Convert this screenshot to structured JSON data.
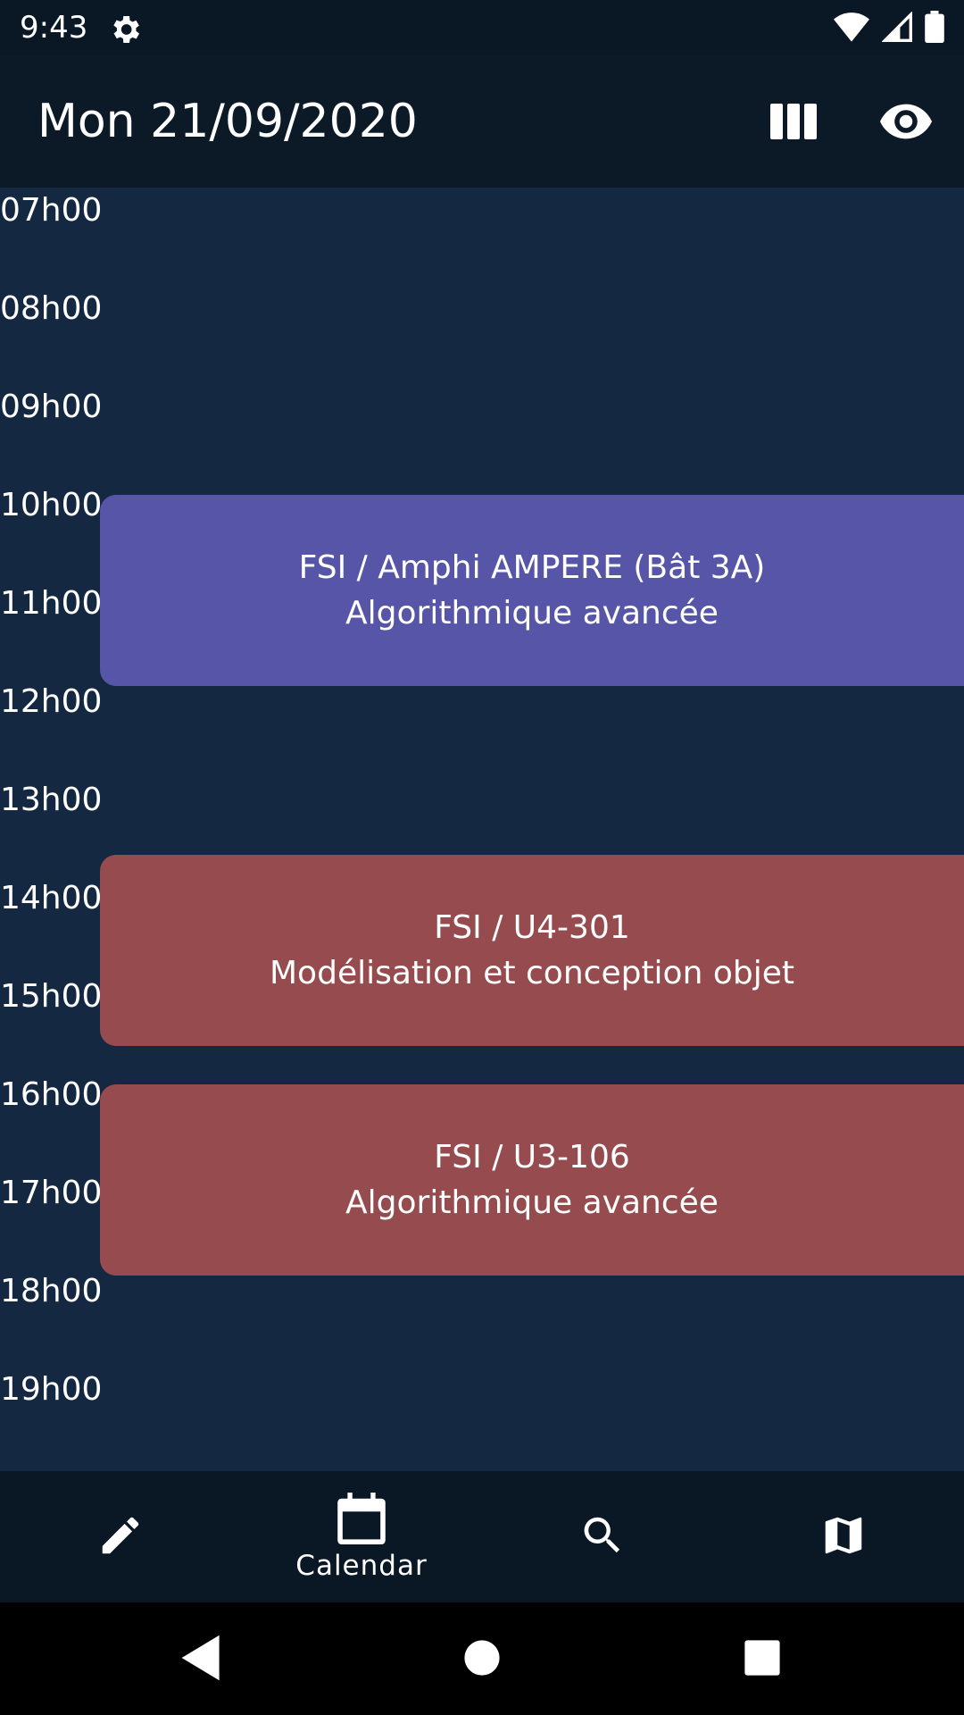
{
  "status_bar": {
    "time": "9:43",
    "icons": [
      "gear-icon",
      "wifi-icon",
      "signal-icon",
      "battery-icon"
    ]
  },
  "app_bar": {
    "title": "Mon 21/09/2020",
    "actions": [
      "view-columns-icon",
      "eye-icon"
    ]
  },
  "timeline": {
    "hours": [
      "07h00",
      "08h00",
      "09h00",
      "10h00",
      "11h00",
      "12h00",
      "13h00",
      "14h00",
      "15h00",
      "16h00",
      "17h00",
      "18h00",
      "19h00"
    ]
  },
  "events": [
    {
      "location": "FSI / Amphi AMPERE (Bât 3A)",
      "course": "Algorithmique avancée",
      "color": "#5655a8"
    },
    {
      "location": "FSI / U4-301",
      "course": "Modélisation et conception objet",
      "color": "#964b4f"
    },
    {
      "location": "FSI / U3-106",
      "course": "Algorithmique avancée",
      "color": "#964b4f"
    }
  ],
  "bottom_nav": {
    "items": [
      {
        "icon": "pencil-icon",
        "label": ""
      },
      {
        "icon": "calendar-icon",
        "label": "Calendar"
      },
      {
        "icon": "search-icon",
        "label": ""
      },
      {
        "icon": "map-icon",
        "label": ""
      }
    ],
    "active": "Calendar"
  },
  "system_nav": [
    "back-icon",
    "home-icon",
    "recents-icon"
  ],
  "colors": {
    "background": "#142841",
    "app_bar": "#0c1a28",
    "bottom_nav": "#0a1826"
  }
}
